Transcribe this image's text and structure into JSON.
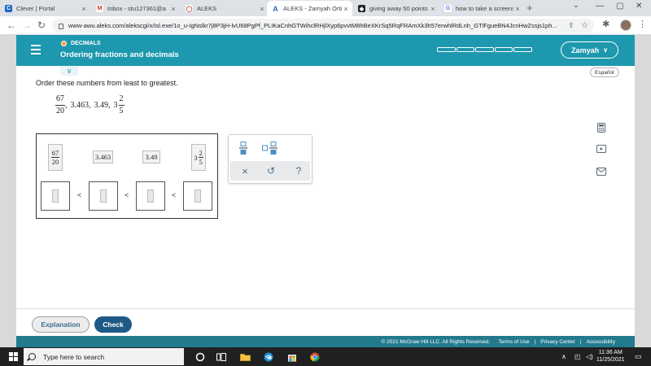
{
  "browser": {
    "tabs": [
      {
        "title": "Clever | Portal",
        "favicon": "clever-icon",
        "color": "#1d64c4",
        "glyph": "C"
      },
      {
        "title": "Inbox - stu127361@a",
        "favicon": "gmail-icon",
        "color": "#d93025",
        "glyph": "M"
      },
      {
        "title": "ALEKS",
        "favicon": "aleks-ring-icon",
        "color": "#c62828",
        "glyph": "◯"
      },
      {
        "title": "ALEKS - Zamyah Orti",
        "favicon": "aleks-a-icon",
        "color": "#2d6fb7",
        "glyph": "A"
      },
      {
        "title": "giving away 50 points",
        "favicon": "brainly-icon",
        "color": "#222222",
        "glyph": "◆"
      },
      {
        "title": "how to take a screens",
        "favicon": "google-icon",
        "color": "#4285f4",
        "glyph": "G"
      }
    ],
    "url": "www-awu.aleks.com/alekscgi/x/Isl.exe/1o_u-IgNslkr7j8P3jH-lvU68PgPf_PLIKaCnhGTWihclRHjlXyp6pvvtM8hBeXKrSq5RqFRAmXk3h57erwhlRdLnh_GTlFgueBN4JcnHwZssjs1ph..."
  },
  "header": {
    "section": "DECIMALS",
    "topic": "Ordering fractions and decimals",
    "user": "Zamyah"
  },
  "content": {
    "espanol": "Español",
    "question": "Order these numbers from least to greatest.",
    "given": {
      "frac_num": "67",
      "frac_den": "20",
      "sep1": ",",
      "dec1": "3.463,",
      "dec2": "3.49,",
      "mixed_whole": "3",
      "mixed_num": "2",
      "mixed_den": "5"
    },
    "tiles": {
      "t1_num": "67",
      "t1_den": "20",
      "t2": "3.463",
      "t3": "3.49",
      "t4_whole": "3",
      "t4_num": "2",
      "t4_den": "5"
    },
    "less_than": "<"
  },
  "tools": {
    "clear": "×",
    "undo": "↺",
    "help": "?"
  },
  "buttons": {
    "explanation": "Explanation",
    "check": "Check"
  },
  "footer": {
    "copyright": "© 2021 McGraw Hill LLC. All Rights Reserved.",
    "terms": "Terms of Use",
    "privacy": "Privacy Center",
    "accessibility": "Accessibility",
    "sep": "|"
  },
  "taskbar": {
    "search_placeholder": "Type here to search",
    "time": "11:36 AM",
    "date": "11/25/2021"
  },
  "colors": {
    "aleks_teal": "#1e98ae",
    "check_blue": "#1f5a86",
    "footer_teal": "#237a8d"
  }
}
